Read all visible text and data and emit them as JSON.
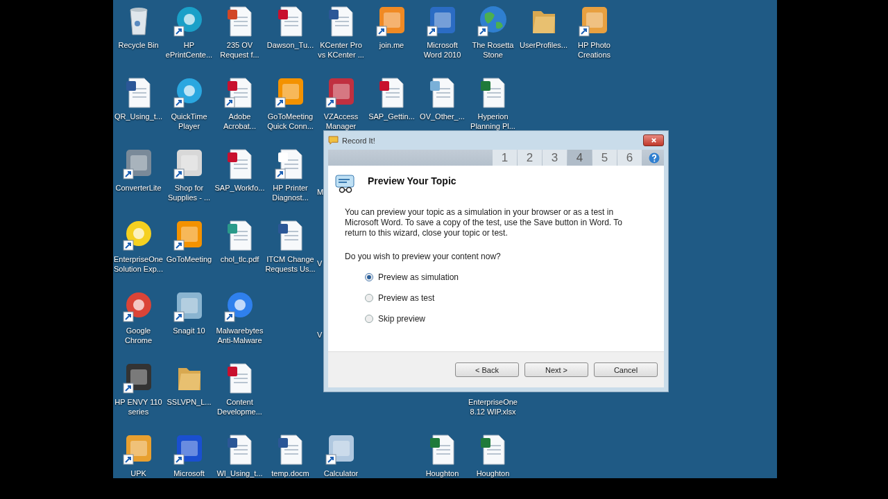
{
  "desktop": {
    "rows": [
      [
        {
          "kind": "icon",
          "label": "Recycle Bin",
          "shortcut": false
        },
        {
          "kind": "icon",
          "label": "HP ePrintCente...",
          "shortcut": true
        },
        {
          "kind": "icon",
          "label": "235 OV Request f...",
          "shortcut": false
        },
        {
          "kind": "icon",
          "label": "Dawson_Tu...",
          "shortcut": false
        },
        {
          "kind": "icon",
          "label": "KCenter Pro vs KCenter ...",
          "shortcut": false
        },
        {
          "kind": "icon",
          "label": "join.me",
          "shortcut": true
        },
        {
          "kind": "icon",
          "label": "Microsoft Word 2010",
          "shortcut": true
        },
        {
          "kind": "icon",
          "label": "The Rosetta Stone",
          "shortcut": true
        },
        {
          "kind": "icon",
          "label": "UserProfiles...",
          "shortcut": false
        },
        {
          "kind": "icon",
          "label": "HP Photo Creations",
          "shortcut": true
        }
      ],
      [
        {
          "kind": "icon",
          "label": "QR_Using_t...",
          "shortcut": false
        },
        {
          "kind": "icon",
          "label": "QuickTime Player",
          "shortcut": true
        },
        {
          "kind": "icon",
          "label": "Adobe Acrobat...",
          "shortcut": true
        },
        {
          "kind": "icon",
          "label": "GoToMeeting Quick Conn...",
          "shortcut": true
        },
        {
          "kind": "icon",
          "label": "VZAccess Manager",
          "shortcut": true
        },
        {
          "kind": "icon",
          "label": "SAP_Gettin...",
          "shortcut": false
        },
        {
          "kind": "icon",
          "label": "OV_Other_...",
          "shortcut": false
        },
        {
          "kind": "icon",
          "label": "Hyperion Planning Pl...",
          "shortcut": false
        }
      ],
      [
        {
          "kind": "icon",
          "label": "ConverterLite",
          "shortcut": true
        },
        {
          "kind": "icon",
          "label": "Shop for Supplies - ...",
          "shortcut": true
        },
        {
          "kind": "icon",
          "label": "SAP_Workfo...",
          "shortcut": false
        },
        {
          "kind": "icon",
          "label": "HP Printer Diagnost...",
          "shortcut": true
        },
        {
          "kind": "partial",
          "label": "M"
        }
      ],
      [
        {
          "kind": "icon",
          "label": "EnterpriseOne Solution Exp...",
          "shortcut": true
        },
        {
          "kind": "icon",
          "label": "GoToMeeting",
          "shortcut": true
        },
        {
          "kind": "icon",
          "label": "chol_tlc.pdf",
          "shortcut": false
        },
        {
          "kind": "icon",
          "label": "ITCM Change Requests Us...",
          "shortcut": false
        },
        {
          "kind": "partial",
          "label": "V"
        }
      ],
      [
        {
          "kind": "icon",
          "label": "Google Chrome",
          "shortcut": true
        },
        {
          "kind": "icon",
          "label": "Snagit 10",
          "shortcut": true
        },
        {
          "kind": "icon",
          "label": "Malwarebytes Anti-Malware",
          "shortcut": true
        },
        {
          "kind": "gap"
        },
        {
          "kind": "partial",
          "label": "V"
        }
      ],
      [
        {
          "kind": "icon",
          "label": "HP ENVY 110 series",
          "shortcut": true
        },
        {
          "kind": "icon",
          "label": "SSLVPN_L...",
          "shortcut": false
        },
        {
          "kind": "icon",
          "label": "Content Developme...",
          "shortcut": false
        },
        {
          "kind": "gap"
        },
        {
          "kind": "gap"
        },
        {
          "kind": "gap"
        },
        {
          "kind": "gap"
        },
        {
          "kind": "label",
          "label": "EnterpriseOne 8.12 WIP.xlsx"
        }
      ],
      [
        {
          "kind": "icon",
          "label": "UPK",
          "shortcut": true
        },
        {
          "kind": "icon",
          "label": "Microsoft",
          "shortcut": true
        },
        {
          "kind": "icon",
          "label": "WI_Using_t...",
          "shortcut": false
        },
        {
          "kind": "icon",
          "label": "temp.docm",
          "shortcut": false
        },
        {
          "kind": "icon",
          "label": "Calculator",
          "shortcut": true
        },
        {
          "kind": "gap"
        },
        {
          "kind": "icon",
          "label": "Houghton",
          "shortcut": false
        },
        {
          "kind": "icon",
          "label": "Houghton",
          "shortcut": false
        }
      ]
    ]
  },
  "dialog": {
    "title": "Record It!",
    "steps": [
      {
        "label": "1",
        "selected": false
      },
      {
        "label": "2",
        "selected": false
      },
      {
        "label": "3",
        "selected": false
      },
      {
        "label": "4",
        "selected": true
      },
      {
        "label": "5",
        "selected": false
      },
      {
        "label": "6",
        "selected": false
      }
    ],
    "heading": "Preview Your Topic",
    "description": "You can preview your topic as a simulation in your browser or as a test in Microsoft Word. To save a copy of the test, use the Save button in Word. To return to this wizard, close your topic or test.",
    "question": "Do you wish to preview your content now?",
    "options": [
      {
        "label": "Preview as simulation",
        "selected": true
      },
      {
        "label": "Preview as test",
        "selected": false
      },
      {
        "label": "Skip preview",
        "selected": false
      }
    ],
    "buttons": [
      "< Back",
      "Next >",
      "Cancel"
    ]
  }
}
